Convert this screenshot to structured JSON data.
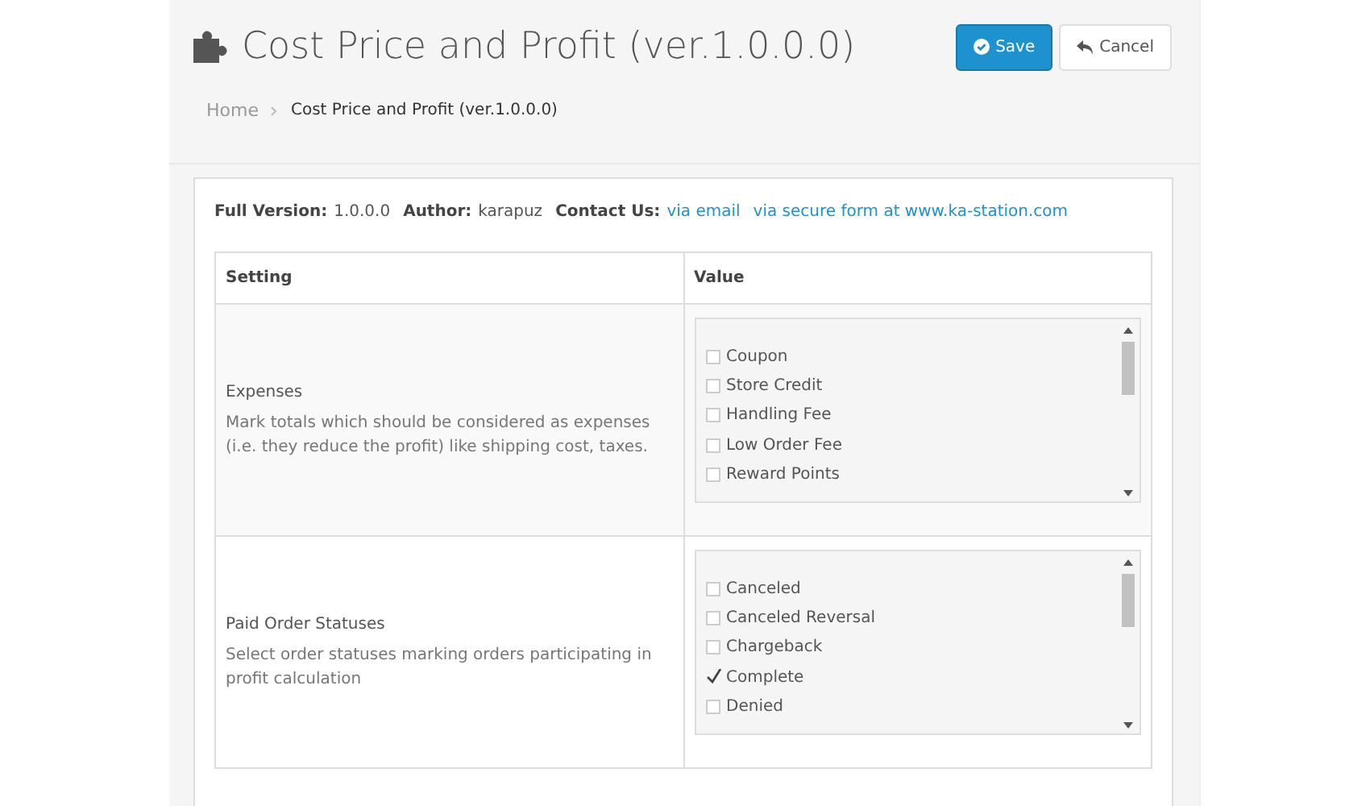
{
  "header": {
    "title": "Cost Price and Profit (ver.1.0.0.0)",
    "buttons": [
      {
        "kind": "save",
        "label": "Save"
      },
      {
        "kind": "cancel",
        "label": "Cancel"
      }
    ]
  },
  "breadcrumb": [
    {
      "label": "Home",
      "selected": false
    },
    {
      "label": "Cost Price and Profit (ver.1.0.0.0)",
      "selected": true
    }
  ],
  "info": [
    {
      "kind": "text",
      "label": "Full Version:",
      "value": "1.0.0.0"
    },
    {
      "kind": "text",
      "label": "Author:",
      "value": "karapuz"
    },
    {
      "kind": "links",
      "label": "Contact Us:",
      "links": [
        "via email",
        "via secure form at www.ka-station.com"
      ]
    }
  ],
  "table": {
    "columns": [
      "Setting",
      "Value"
    ],
    "rows": [
      {
        "title": "Expenses",
        "description": "Mark totals which should be considered as expenses (i.e. they reduce the profit) like shipping cost, taxes.",
        "options": [
          {
            "label": "Coupon",
            "checked": false
          },
          {
            "label": "Store Credit",
            "checked": false
          },
          {
            "label": "Handling Fee",
            "checked": false
          },
          {
            "label": "Low Order Fee",
            "checked": false
          },
          {
            "label": "Reward Points",
            "checked": false
          }
        ]
      },
      {
        "title": "Paid Order Statuses",
        "description": "Select order statuses marking orders participating in profit calculation",
        "options": [
          {
            "label": "Canceled",
            "checked": false
          },
          {
            "label": "Canceled Reversal",
            "checked": false
          },
          {
            "label": "Chargeback",
            "checked": false
          },
          {
            "label": "Complete",
            "checked": true
          },
          {
            "label": "Denied",
            "checked": false
          }
        ]
      }
    ]
  }
}
